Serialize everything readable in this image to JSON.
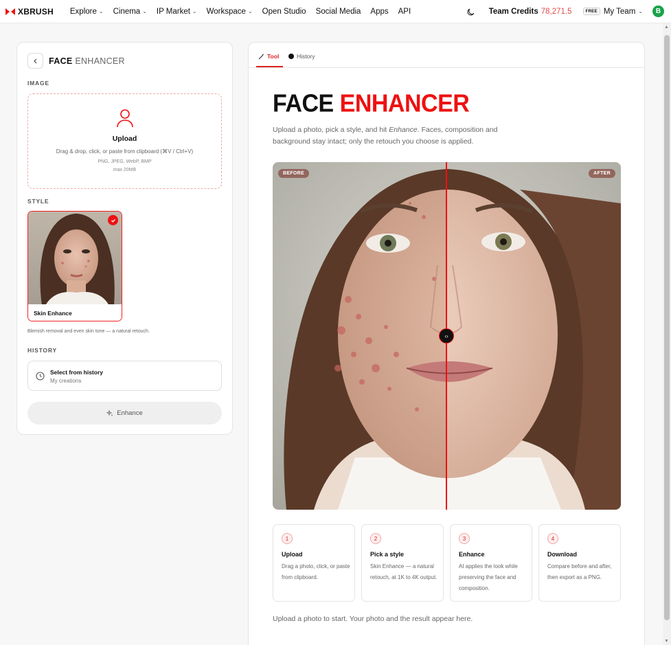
{
  "nav": {
    "logo": "XBRUSH",
    "items": [
      {
        "label": "Explore",
        "dropdown": true
      },
      {
        "label": "Cinema",
        "dropdown": true
      },
      {
        "label": "IP Market",
        "dropdown": true
      },
      {
        "label": "Workspace",
        "dropdown": true
      },
      {
        "label": "Open Studio",
        "dropdown": false
      },
      {
        "label": "Social Media",
        "dropdown": false
      },
      {
        "label": "Apps",
        "dropdown": false
      },
      {
        "label": "API",
        "dropdown": false
      }
    ],
    "credits_label": "Team Credits",
    "credits_value": "78,271.5",
    "plan_badge": "FREE",
    "team": "My Team",
    "avatar_initial": "B"
  },
  "left": {
    "title_bold": "FACE",
    "title_light": "ENHANCER",
    "image_label": "IMAGE",
    "upload": {
      "title": "Upload",
      "subtitle": "Drag & drop, click, or paste from clipboard (⌘V / Ctrl+V)",
      "formats": "PNG, JPEG, WebP, BMP",
      "max": "max 20MB"
    },
    "style_label": "STYLE",
    "style_card": {
      "name": "Skin Enhance",
      "selected": true
    },
    "style_desc": "Blemish removal and even skin tone — a natural retouch.",
    "history_label": "HISTORY",
    "history_box": {
      "title": "Select from history",
      "subtitle": "My creations"
    },
    "enhance_label": "Enhance"
  },
  "right": {
    "tabs": [
      {
        "label": "Tool",
        "active": true
      },
      {
        "label": "History",
        "active": false
      }
    ],
    "hero_black": "FACE",
    "hero_red": "ENHANCER",
    "desc_before": "Upload a photo, pick a style, and hit ",
    "desc_em": "Enhance",
    "desc_after": ". Faces, composition and background stay intact; only the retouch you choose is applied.",
    "badge_before": "BEFORE",
    "badge_after": "AFTER",
    "steps": [
      {
        "num": "1",
        "title": "Upload",
        "desc": "Drag a photo, click, or paste from clipboard."
      },
      {
        "num": "2",
        "title": "Pick a style",
        "desc": "Skin Enhance — a natural retouch, at 1K to 4K output."
      },
      {
        "num": "3",
        "title": "Enhance",
        "desc": "AI applies the look while preserving the face and composition."
      },
      {
        "num": "4",
        "title": "Download",
        "desc": "Compare before and after, then export as a PNG."
      }
    ],
    "footer_note": "Upload a photo to start. Your photo and the result appear here."
  },
  "colors": {
    "accent": "#e11111",
    "credits": "#e34b4b",
    "avatar": "#1aa34a"
  }
}
